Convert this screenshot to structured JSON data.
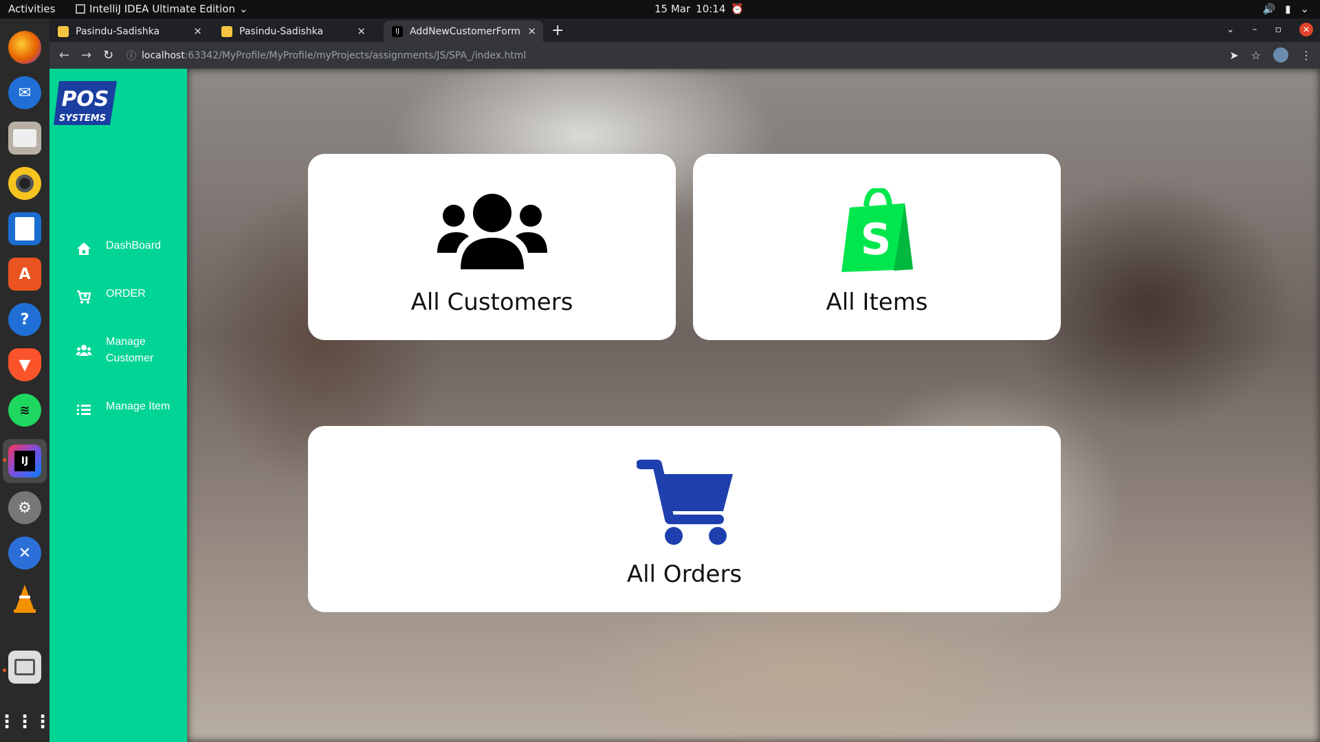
{
  "system": {
    "activities": "Activities",
    "app_name": "IntelliJ IDEA Ultimate Edition",
    "date": "15 Mar",
    "time": "10:14"
  },
  "browser": {
    "tabs": [
      {
        "title": "Pasindu-Sadishka",
        "active": false
      },
      {
        "title": "Pasindu-Sadishka",
        "active": false
      },
      {
        "title": "AddNewCustomerForm",
        "active": true
      }
    ],
    "url_host": "localhost",
    "url_rest": ":63342/MyProfile/MyProfile/myProjects/assignments/JS/SPA_/index.html"
  },
  "sidebar": {
    "logo_line1": "POS",
    "logo_line2": "SYSTEMS",
    "items": [
      {
        "label": "DashBoard",
        "icon": "home-icon"
      },
      {
        "label": "ORDER",
        "icon": "cart-plus-icon"
      },
      {
        "label_line1": "Manage",
        "label_line2": "Customer",
        "icon": "users-icon"
      },
      {
        "label": "Manage Item",
        "icon": "list-icon"
      }
    ]
  },
  "cards": [
    {
      "title": "All Customers",
      "icon": "users-icon"
    },
    {
      "title": "All Items",
      "icon": "shopify-bag-icon",
      "icon_color": "#00e64d"
    },
    {
      "title": "All Orders",
      "icon": "shopping-cart-icon",
      "icon_color": "#1e40af"
    }
  ],
  "colors": {
    "sidebar": "#02d495",
    "card_bg": "#ffffff"
  }
}
